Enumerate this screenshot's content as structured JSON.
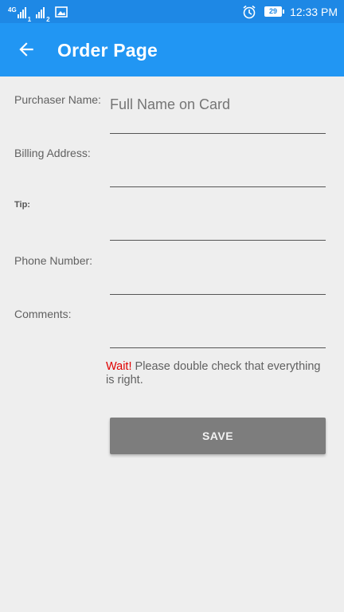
{
  "status_bar": {
    "network_label": "4G",
    "sim1_label": "1",
    "sim2_label": "2",
    "battery_level": "29",
    "time": "12:33 PM"
  },
  "app_bar": {
    "title": "Order Page",
    "back_icon": "arrow-left-icon"
  },
  "form": {
    "purchaser_label": "Purchaser Name:",
    "purchaser_placeholder": "Full Name on Card",
    "billing_label": "Billing Address:",
    "tip_label": "Tip:",
    "phone_label": "Phone Number:",
    "comments_label": "Comments:"
  },
  "warning": {
    "prefix": "Wait!",
    "text": " Please double check that everything is right."
  },
  "save_button": {
    "label": "SAVE"
  },
  "colors": {
    "status_bar": "#1e88e5",
    "app_bar": "#2196f3",
    "background": "#eeeeee",
    "warning_red": "#e00000",
    "button": "#7d7d7d"
  }
}
